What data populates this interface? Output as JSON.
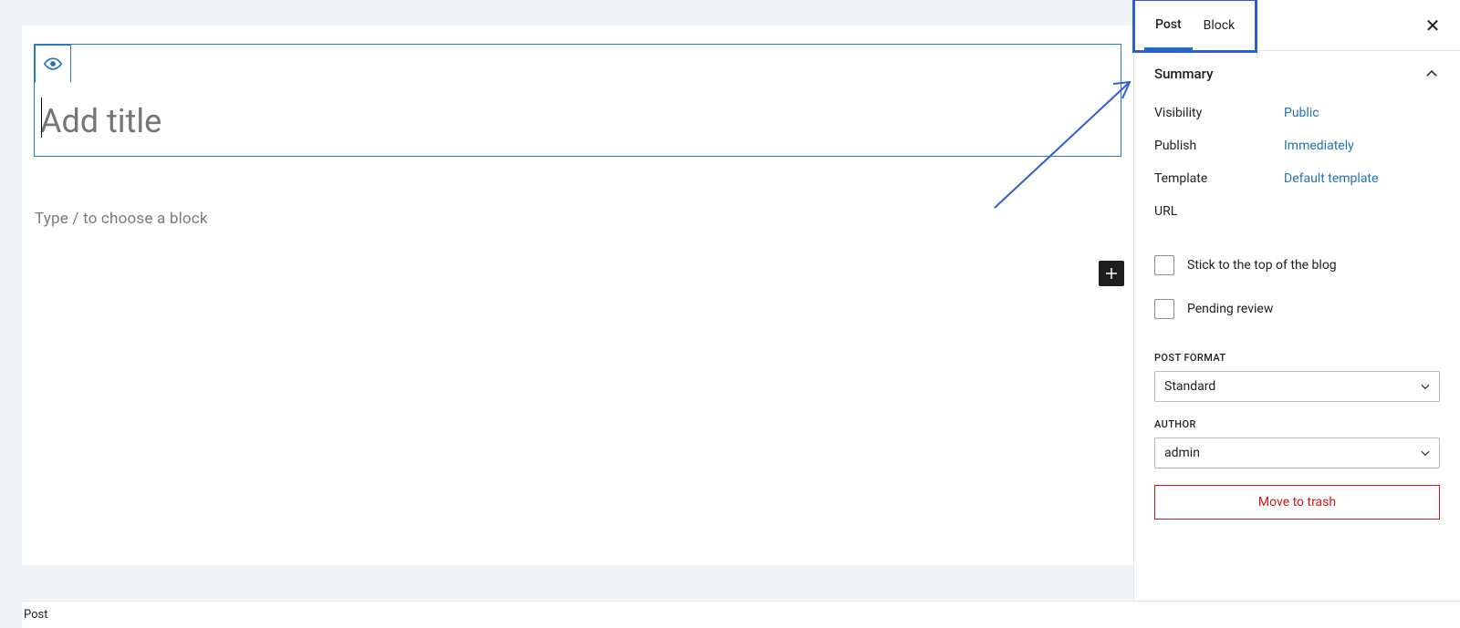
{
  "editor": {
    "title_placeholder": "Add title",
    "block_prompt": "Type / to choose a block"
  },
  "sidebar": {
    "tabs": {
      "post": "Post",
      "block": "Block",
      "active": "post"
    },
    "summary": {
      "heading": "Summary",
      "visibility_label": "Visibility",
      "visibility_value": "Public",
      "publish_label": "Publish",
      "publish_value": "Immediately",
      "template_label": "Template",
      "template_value": "Default template",
      "url_label": "URL",
      "sticky_label": "Stick to the top of the blog",
      "pending_label": "Pending review",
      "post_format_label": "POST FORMAT",
      "post_format_value": "Standard",
      "author_label": "AUTHOR",
      "author_value": "admin",
      "trash_label": "Move to trash"
    }
  },
  "footer": {
    "breadcrumb": "Post"
  }
}
